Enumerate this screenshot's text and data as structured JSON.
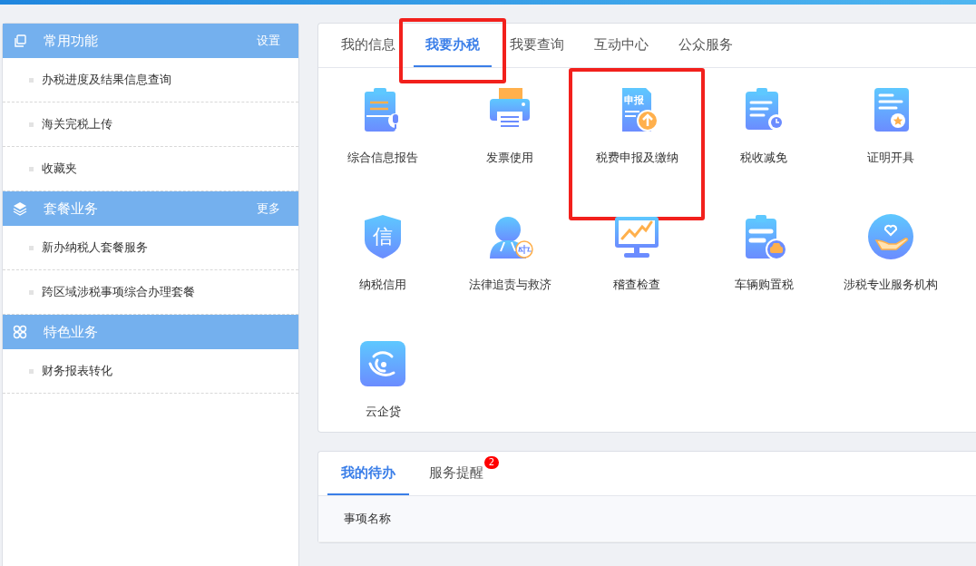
{
  "sidebar": {
    "sections": [
      {
        "title": "常用功能",
        "action": "设置",
        "items": [
          "办税进度及结果信息查询",
          "海关完税上传",
          "收藏夹"
        ]
      },
      {
        "title": "套餐业务",
        "action": "更多",
        "items": [
          "新办纳税人套餐服务",
          "跨区域涉税事项综合办理套餐"
        ]
      },
      {
        "title": "特色业务",
        "items": [
          "财务报表转化"
        ]
      }
    ]
  },
  "main_tabs": [
    {
      "label": "我的信息",
      "selected": false,
      "highlighted": false
    },
    {
      "label": "我要办税",
      "selected": true,
      "highlighted": true
    },
    {
      "label": "我要查询",
      "selected": false,
      "highlighted": false
    },
    {
      "label": "互动中心",
      "selected": false,
      "highlighted": false
    },
    {
      "label": "公众服务",
      "selected": false,
      "highlighted": false
    }
  ],
  "services": [
    {
      "label": "综合信息报告",
      "highlighted": false
    },
    {
      "label": "发票使用",
      "highlighted": false
    },
    {
      "label": "税费申报及缴纳",
      "icon_text": "申报",
      "highlighted": true
    },
    {
      "label": "税收减免",
      "highlighted": false
    },
    {
      "label": "证明开具",
      "highlighted": false
    },
    {
      "label": "纳税信用",
      "icon_text": "信",
      "highlighted": false
    },
    {
      "label": "法律追责与救济",
      "highlighted": false
    },
    {
      "label": "稽查检查",
      "highlighted": false
    },
    {
      "label": "车辆购置税",
      "highlighted": false
    },
    {
      "label": "涉税专业服务机构",
      "highlighted": false
    },
    {
      "label": "云企贷",
      "highlighted": false
    }
  ],
  "todo_tabs": [
    {
      "label": "我的待办",
      "selected": true
    },
    {
      "label": "服务提醒",
      "selected": false,
      "badge": "2"
    }
  ],
  "todo_table": {
    "columns": [
      "事项名称"
    ]
  }
}
